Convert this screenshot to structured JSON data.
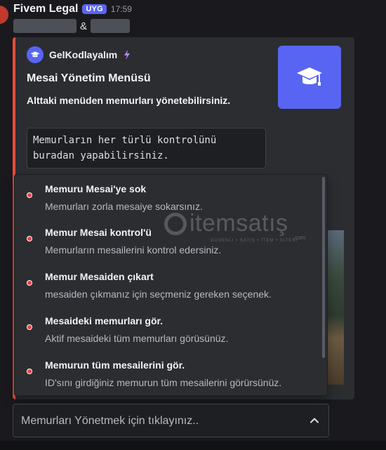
{
  "message": {
    "username": "Fivem Legal",
    "tag": "UYG",
    "time": "17:59",
    "separator": "&"
  },
  "embed": {
    "accent_color": "#e74c3c",
    "author_name": "GelKodlayalım",
    "title": "Mesai Yönetim Menüsü",
    "description": "Alttaki menüden memurları yönetebilirsiniz.",
    "code_line1": "Memurların her türlü kontrolünü",
    "code_line2": "buradan yapabilirsiniz.",
    "thumbnail_icon": "graduation-cap-icon"
  },
  "dropdown": {
    "options": [
      {
        "label": "Memuru Mesai'ye sok",
        "description": "Memurları zorla mesaiye sokarsınız.",
        "icon": "red-circle-icon"
      },
      {
        "label": "Memur Mesai kontrol'ü",
        "description": "Memurların mesailerini kontrol edersiniz.",
        "icon": "red-circle-icon"
      },
      {
        "label": "Memur Mesaiden çıkart",
        "description": "mesaiden çıkmanız için seçmeniz gereken seçenek.",
        "icon": "red-circle-icon"
      },
      {
        "label": "Mesaideki memurları gör.",
        "description": "Aktif mesaideki tüm memurları görüsünüz.",
        "icon": "red-circle-icon"
      },
      {
        "label": "Memurun tüm mesailerini gör.",
        "description": "ID'sını girdiğiniz memurun tüm mesailerini görürsünüz.",
        "icon": "red-circle-icon"
      }
    ]
  },
  "select": {
    "placeholder": "Memurları Yönetmek için tıklayınız..",
    "icon": "chevron-up-icon"
  },
  "watermark": {
    "text": "itemsatış",
    "tagline": "GÜVENLİ • SATIŞ • İTEM • SİTESİ",
    "suffix": ".com"
  }
}
